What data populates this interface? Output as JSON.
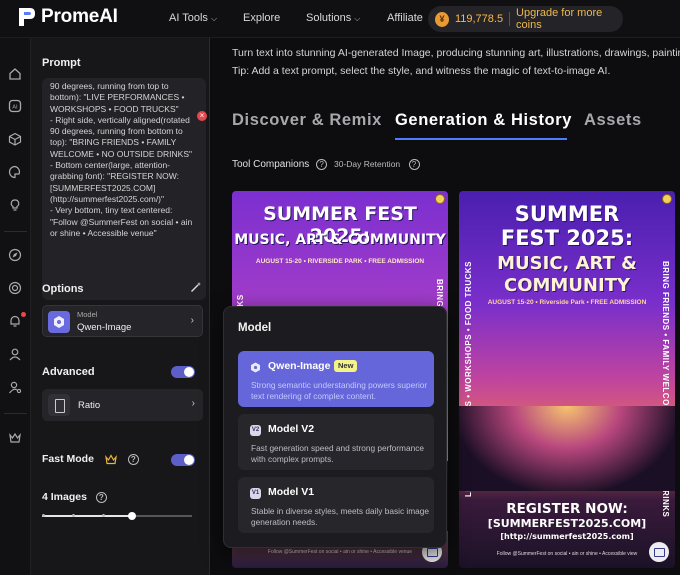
{
  "header": {
    "brand": "PromeAI",
    "nav": [
      {
        "label": "AI Tools",
        "has_caret": true
      },
      {
        "label": "Explore",
        "has_caret": false
      },
      {
        "label": "Solutions",
        "has_caret": true
      },
      {
        "label": "Affiliate",
        "has_caret": false
      }
    ],
    "coins": "119,778.5",
    "upgrade_label": "Upgrade for more coins"
  },
  "sidebar_icons": [
    "home-icon",
    "ai-icon",
    "cube-icon",
    "palette-icon",
    "bulb-icon",
    "compass-icon",
    "target-icon",
    "bell-icon",
    "user-icon",
    "user-settings-icon",
    "crown-icon"
  ],
  "panel": {
    "prompt_title": "Prompt",
    "prompt_text": "90 degrees, running from top to bottom): \"LIVE PERFORMANCES • WORKSHOPS • FOOD TRUCKS\"\n- Right side, vertically aligned(rotated 90 degrees, running from bottom to top): \"BRING FRIENDS • FAMILY WELCOME • NO OUTSIDE DRINKS\"\n- Bottom center(large, attention-grabbing font): \"REGISTER NOW: [SUMMERFEST2025.COM] (http://summerfest2025.com/)\"\n- Very bottom, tiny text centered: \"Follow @SummerFest on social • ain or shine • Accessible venue\"",
    "options_title": "Options",
    "model_label": "Model",
    "model_value": "Qwen-Image",
    "advanced_title": "Advanced",
    "ratio_label": "Ratio",
    "fast_mode_label": "Fast Mode",
    "images_label": "4 Images",
    "images_level": 0.6
  },
  "main": {
    "tagline_1": "Turn text into stunning AI-generated Image, producing stunning art, illustrations, drawings, paintings",
    "tagline_2": "Tip: Add a text prompt, select the style, and witness the magic of text-to-image AI.",
    "tabs": [
      {
        "label": "Discover & Remix",
        "active": false
      },
      {
        "label": "Generation & History",
        "active": true
      },
      {
        "label": "Assets",
        "active": false
      }
    ],
    "tool_companions": "Tool Companions",
    "retention": "30-Day Retention",
    "poster1": {
      "title_line1": "SUMMER FEST 2025:",
      "title_line2": "MUSIC, ART & COMMUNITY",
      "subtitle": "AUGUST 15-20 • RIVERSIDE PARK • FREE ADMISSION",
      "left_vertical": "RCKS",
      "right_vertical": "BRING",
      "footer": "Follow @SummerFest on social  •  ain or shine  •  Accessible venue"
    },
    "poster2": {
      "title_line1": "SUMMER",
      "title_line2": "FEST 2025:",
      "title_line3": "MUSIC, ART &",
      "title_line4": "COMMUNITY",
      "subtitle": "AUGUST 15-20 • Riverside Park • FREE ADMISSION",
      "left_vertical": "LIVE PERFORMANCES • WORKSHOPS • FOOD TRUCKS",
      "right_vertical": "BRING FRIENDS • FAMILY WELCOME • NO OUTHOR DRINKS",
      "register_1": "REGISTER NOW:",
      "register_2": "[SUMMERFEST2025.COM]",
      "register_3": "[http://summerfest2025.com]",
      "footer": "Follow @SummerFest on social  •  ain or shine  •  Accessible view"
    }
  },
  "model_popover": {
    "title": "Model",
    "options": [
      {
        "name": "Qwen-Image",
        "badge": "New",
        "icon": "qwen-icon",
        "desc": "Strong semantic understanding powers superior text rendering of complex content.",
        "selected": true
      },
      {
        "name": "Model V2",
        "badge": "",
        "icon": "V2",
        "desc": "Fast generation speed and strong performance with complex prompts.",
        "selected": false
      },
      {
        "name": "Model V1",
        "badge": "",
        "icon": "V1",
        "desc": "Stable in diverse styles, meets daily basic image generation needs.",
        "selected": false
      }
    ]
  },
  "colors": {
    "accent": "#6466d9",
    "coin": "#ffb648",
    "tab_underline": "#4e7cff"
  }
}
